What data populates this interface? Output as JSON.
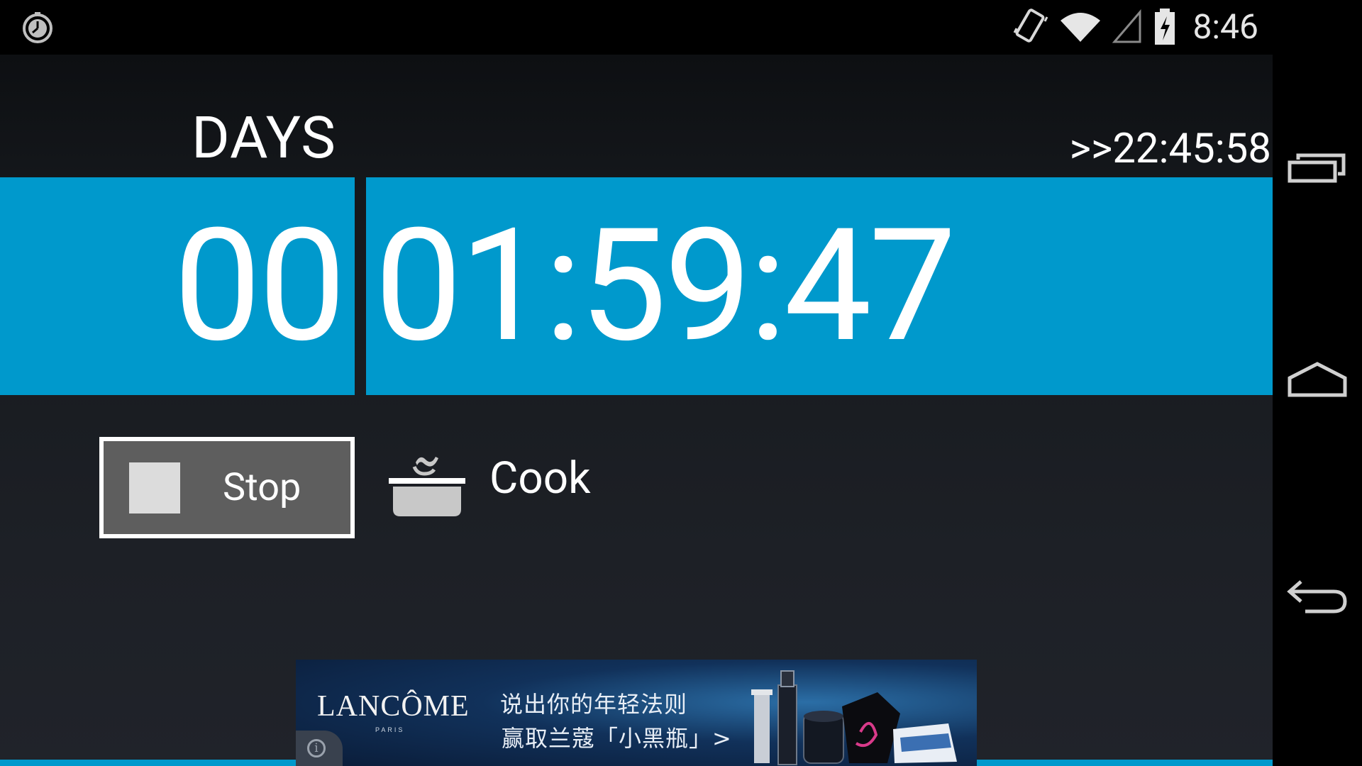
{
  "status_bar": {
    "time": "8:46",
    "icons": [
      "alarm-clock-icon",
      "vibrate-icon",
      "wifi-icon",
      "cell-signal-icon",
      "battery-charging-icon"
    ]
  },
  "timer": {
    "days_label": "DAYS",
    "target_time": ">>22:45:58",
    "days_value": "00",
    "time_value": "01:59:47",
    "accent_color": "#0099cc"
  },
  "controls": {
    "stop_label": "Stop",
    "category_label": "Cook",
    "category_icon": "cooking-pot-icon"
  },
  "ad": {
    "brand": "LANCÔME",
    "brand_sub": "PARIS",
    "line1": "说出你的年轻法则",
    "line2": "赢取兰蔻「小黑瓶」>",
    "info_glyph": "i"
  },
  "nav_bar": {
    "buttons": [
      "recent-apps-icon",
      "home-icon",
      "back-icon"
    ]
  }
}
